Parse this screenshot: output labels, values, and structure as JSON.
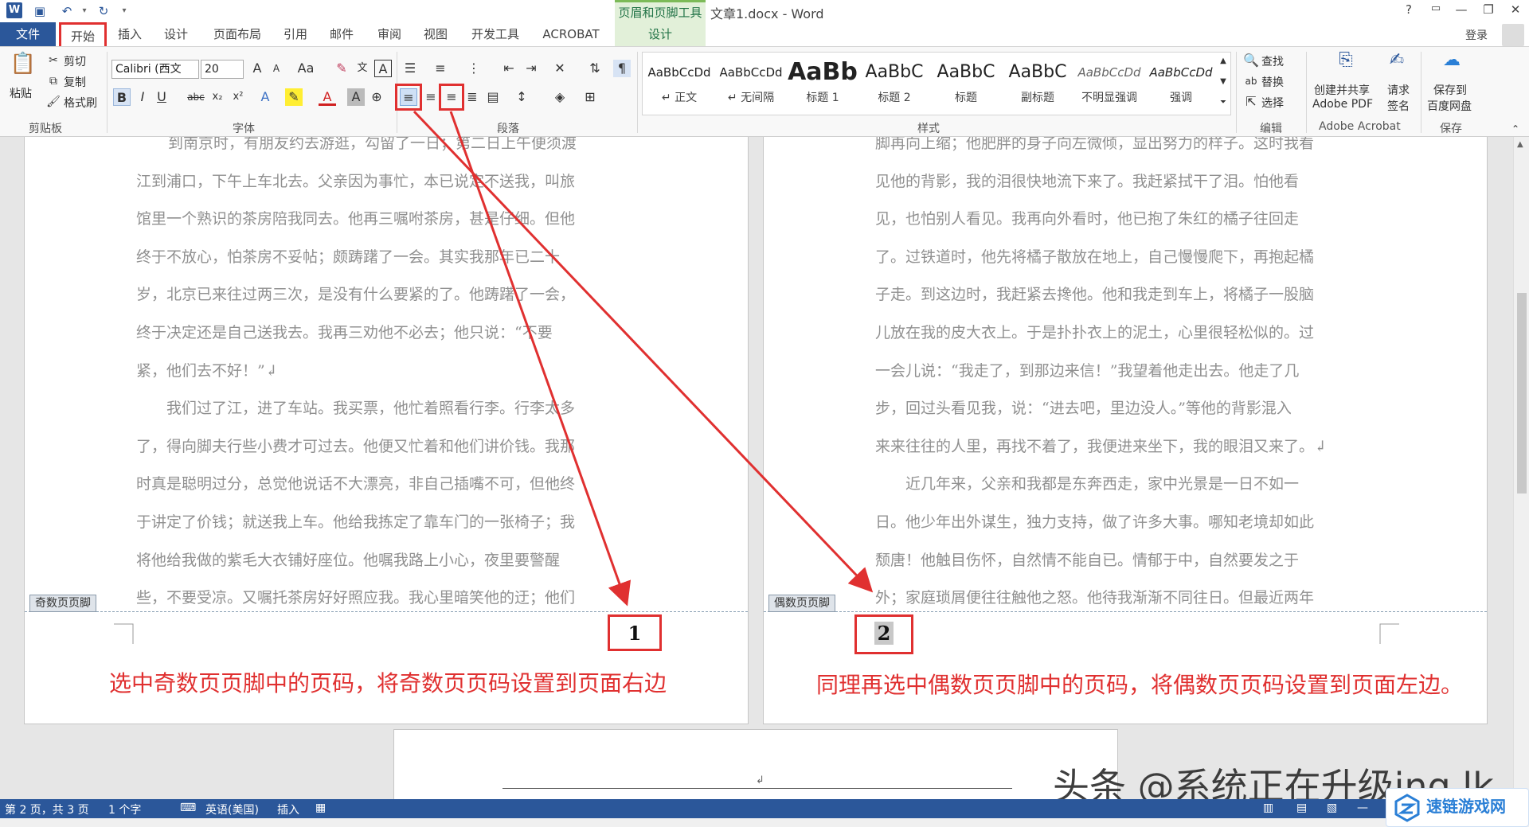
{
  "window": {
    "title": "文章1.docx - Word",
    "context_tool": "页眉和页脚工具",
    "help": "?",
    "restore_icon": "ribbon-display-icon",
    "minimize": "—",
    "maximize": "❐",
    "close": "✕"
  },
  "tabs": {
    "file": "文件",
    "home": "开始",
    "insert": "插入",
    "design": "设计",
    "layout": "页面布局",
    "references": "引用",
    "mailings": "邮件",
    "review": "审阅",
    "view": "视图",
    "developer": "开发工具",
    "acrobat": "ACROBAT",
    "hf_design": "设计",
    "login": "登录"
  },
  "ribbon": {
    "clipboard": {
      "paste": "粘贴",
      "cut": "剪切",
      "copy": "复制",
      "format_painter": "格式刷",
      "label": "剪贴板"
    },
    "font": {
      "name": "Calibri (西文",
      "size": "20",
      "label": "字体"
    },
    "paragraph": {
      "label": "段落"
    },
    "styles": {
      "label": "样式",
      "items": [
        {
          "sample": "AaBbCcDd",
          "name": "↵ 正文"
        },
        {
          "sample": "AaBbCcDd",
          "name": "↵ 无间隔"
        },
        {
          "sample": "AaBb",
          "name": "标题 1"
        },
        {
          "sample": "AaBbC",
          "name": "标题 2"
        },
        {
          "sample": "AaBbC",
          "name": "标题"
        },
        {
          "sample": "AaBbC",
          "name": "副标题"
        },
        {
          "sample": "AaBbCcDd",
          "name": "不明显强调"
        },
        {
          "sample": "AaBbCcDd",
          "name": "强调"
        }
      ]
    },
    "editing": {
      "find": "查找",
      "replace": "替换",
      "select": "选择",
      "label": "编辑"
    },
    "acrobat": {
      "create_share_1": "创建并共享",
      "create_share_2": "Adobe PDF",
      "request_1": "请求",
      "request_2": "签名",
      "label": "Adobe Acrobat"
    },
    "save": {
      "save_1": "保存到",
      "save_2": "百度网盘",
      "label": "保存"
    }
  },
  "document": {
    "page1": {
      "lines": [
        "到南京时，有朋友约去游逛，勾留了一日；第二日上午便须渡",
        "江到浦口，下午上车北去。父亲因为事忙，本已说定不送我，叫旅",
        "馆里一个熟识的茶房陪我同去。他再三嘱咐茶房，甚是仔细。但他",
        "终于不放心，怕茶房不妥帖；颇踌躇了一会。其实我那年已二十",
        "岁，北京已来往过两三次，是没有什么要紧的了。他踌躇了一会，",
        "终于决定还是自己送我去。我再三劝他不必去；他只说：“不要",
        "紧，他们去不好！”↲",
        "我们过了江，进了车站。我买票，他忙着照看行李。行李太多",
        "了，得向脚夫行些小费才可过去。他便又忙着和他们讲价钱。我那",
        "时真是聪明过分，总觉他说话不大漂亮，非自己插嘴不可，但他终",
        "于讲定了价钱；就送我上车。他给我拣定了靠车门的一张椅子；我",
        "将他给我做的紫毛大衣铺好座位。他嘱我路上小心，夜里要警醒",
        "些，不要受凉。又嘱托茶房好好照应我。我心里暗笑他的迂；他们"
      ],
      "footer_tag": "奇数页页脚",
      "page_number": "1",
      "annotation": "选中奇数页页脚中的页码，将奇数页页码设置到页面右边"
    },
    "page2": {
      "lines": [
        "脚再向上缩；他肥胖的身子向左微倾，显出努力的样子。这时我看",
        "见他的背影，我的泪很快地流下来了。我赶紧拭干了泪。怕他看",
        "见，也怕别人看见。我再向外看时，他已抱了朱红的橘子往回走",
        "了。过铁道时，他先将橘子散放在地上，自己慢慢爬下，再抱起橘",
        "子走。到这边时，我赶紧去搀他。他和我走到车上，将橘子一股脑",
        "儿放在我的皮大衣上。于是扑扑衣上的泥土，心里很轻松似的。过",
        "一会儿说：“我走了，到那边来信！”我望着他走出去。他走了几",
        "步，回过头看见我，说：“进去吧，里边没人。”等他的背影混入",
        "来来往往的人里，再找不着了，我便进来坐下，我的眼泪又来了。↲",
        "近几年来，父亲和我都是东奔西走，家中光景是一日不如一",
        "日。他少年出外谋生，独力支持，做了许多大事。哪知老境却如此",
        "颓唐！他触目伤怀，自然情不能自已。情郁于中，自然要发之于",
        "外；家庭琐屑便往往触他之怒。他待我渐渐不同往日。但最近两年"
      ],
      "footer_tag": "偶数页页脚",
      "page_number": "2",
      "annotation": "同理再选中偶数页页脚中的页码，将偶数页页码设置到页面左边。"
    },
    "page3_mark": "↲"
  },
  "statusbar": {
    "page": "第 2 页，共 3 页",
    "words": "1 个字",
    "language": "英语(美国)",
    "mode": "插入",
    "zoom_minus": "—"
  },
  "watermark": {
    "text": "头条 @系统正在升级ing.lk",
    "logo": "速链游戏网"
  },
  "colors": {
    "accent": "#2b579a",
    "annotation_red": "#e03030",
    "context_green": "#217346"
  }
}
